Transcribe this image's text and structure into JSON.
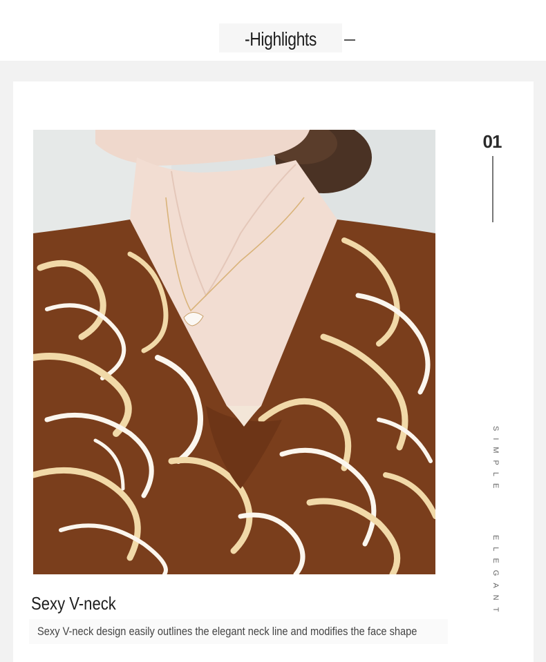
{
  "header": {
    "title": "-Highlights"
  },
  "feature": {
    "number": "01",
    "vertical_word_1": "SIMPLE",
    "vertical_word_2": "ELEGANT",
    "title": "Sexy V-neck",
    "description": "Sexy V-neck design easily outlines the elegant neck line and modifies the face shape",
    "image_subject": "product-photo-v-neck-brown-swirl-print-dress"
  },
  "colors": {
    "page_band": "#f2f2f2",
    "fabric_brown": "#7a3e1c",
    "fabric_cream": "#f1d9a8",
    "fabric_white": "#fbf6ee",
    "skin": "#f2ddd2",
    "hair": "#4a3224"
  }
}
